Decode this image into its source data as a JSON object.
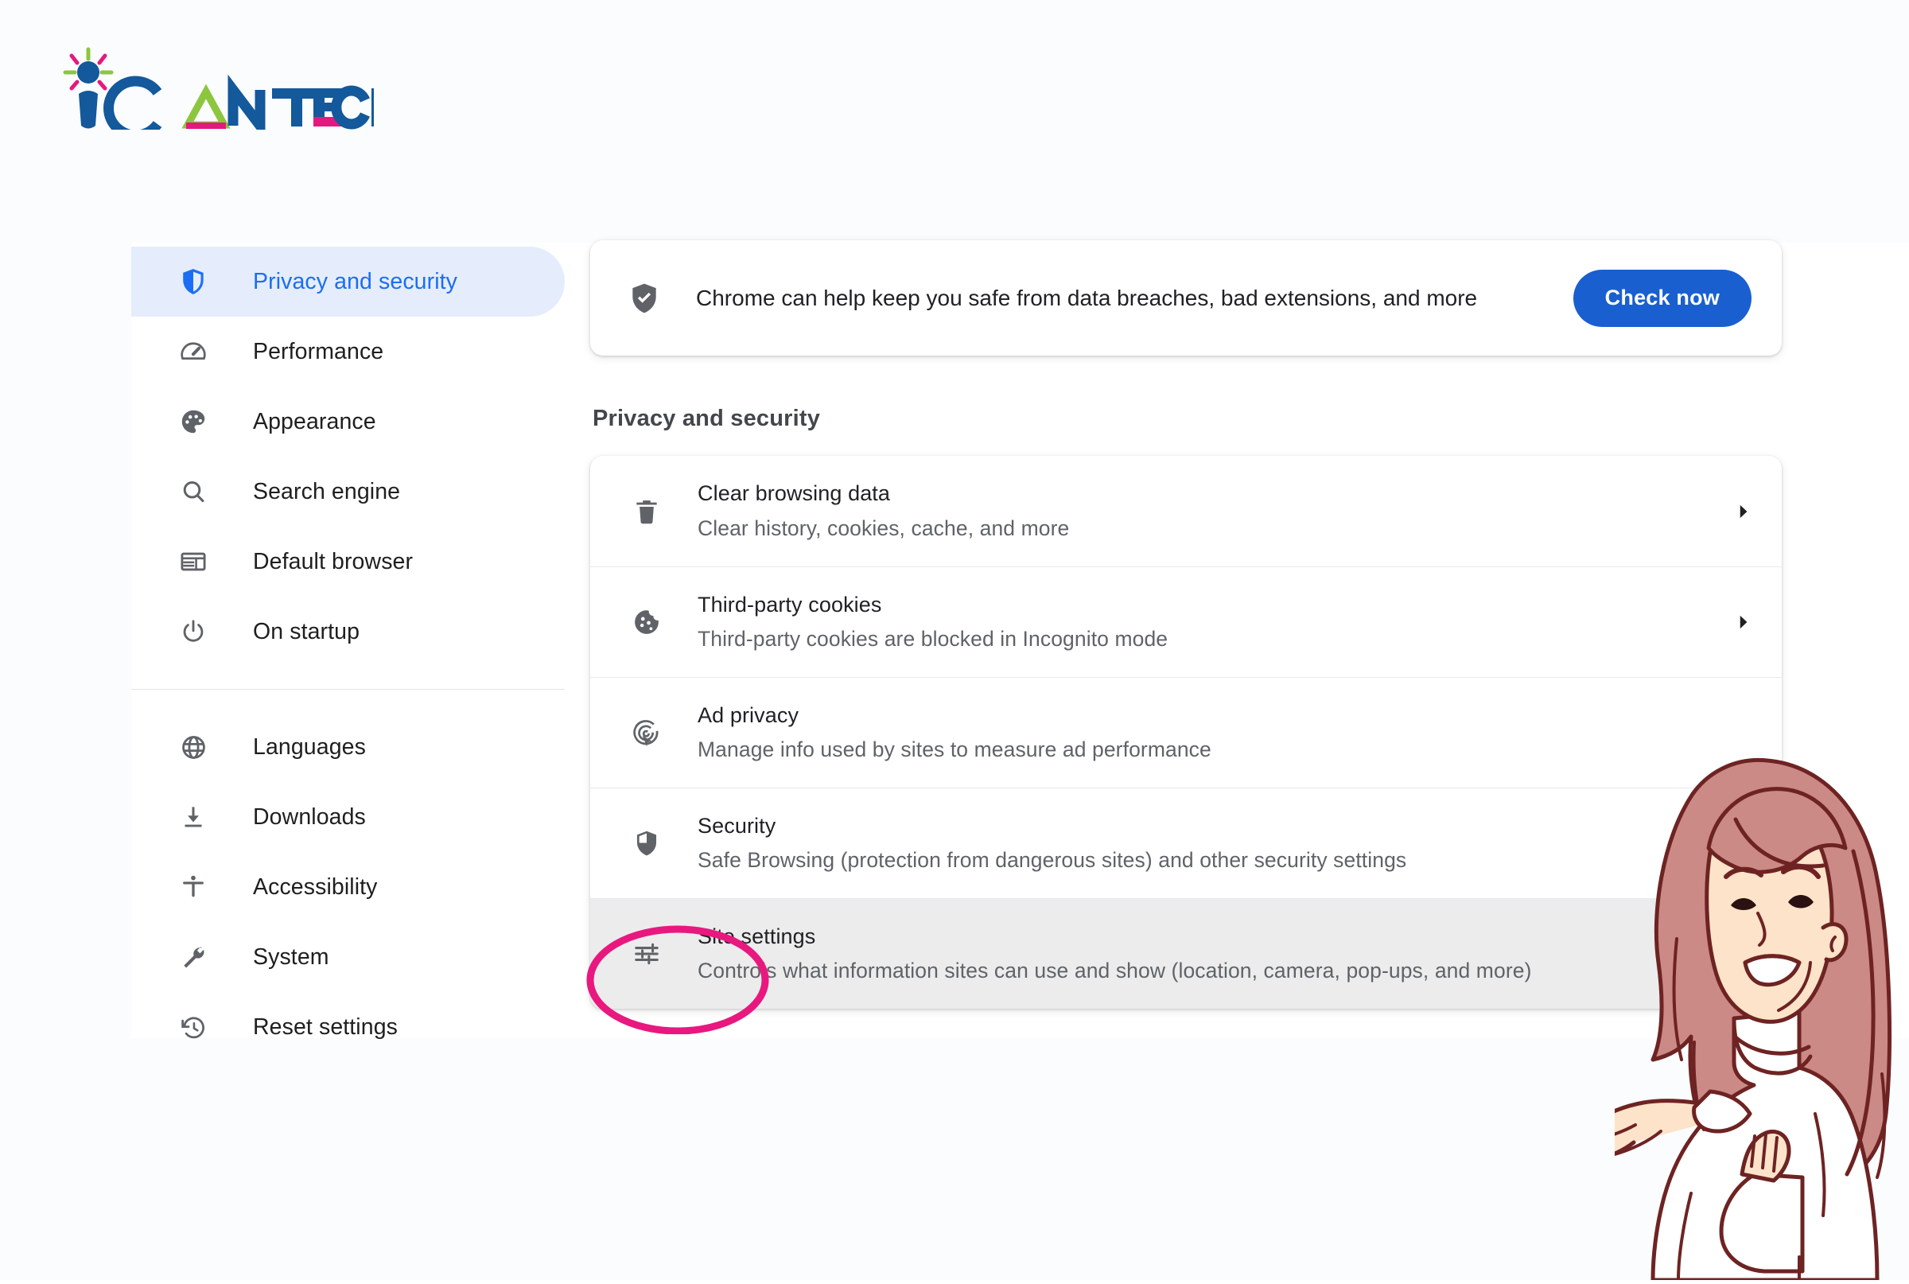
{
  "brand": {
    "name": "iCAN TECH",
    "colors": {
      "blue": "#13599b",
      "green": "#8cc63e",
      "magenta": "#e4197f"
    }
  },
  "sidebar": {
    "group_one": [
      {
        "label": "Privacy and security",
        "icon": "shield-icon",
        "active": true
      },
      {
        "label": "Performance",
        "icon": "speedometer-icon",
        "active": false
      },
      {
        "label": "Appearance",
        "icon": "palette-icon",
        "active": false
      },
      {
        "label": "Search engine",
        "icon": "search-icon",
        "active": false
      },
      {
        "label": "Default browser",
        "icon": "browser-window-icon",
        "active": false
      },
      {
        "label": "On startup",
        "icon": "power-icon",
        "active": false
      }
    ],
    "group_two": [
      {
        "label": "Languages",
        "icon": "globe-icon",
        "active": false
      },
      {
        "label": "Downloads",
        "icon": "download-icon",
        "active": false
      },
      {
        "label": "Accessibility",
        "icon": "accessibility-icon",
        "active": false
      },
      {
        "label": "System",
        "icon": "wrench-icon",
        "active": false
      },
      {
        "label": "Reset settings",
        "icon": "history-restore-icon",
        "active": false
      }
    ]
  },
  "safety_check": {
    "icon": "shield-check-icon",
    "message": "Chrome can help keep you safe from data breaches, bad extensions, and more",
    "button_label": "Check now",
    "button_color": "#1a5fd0"
  },
  "main": {
    "section_title": "Privacy and security",
    "rows": [
      {
        "title": "Clear browsing data",
        "subtitle": "Clear history, cookies, cache, and more",
        "icon": "trash-icon",
        "arrow": "chevron-right-icon",
        "highlighted": false
      },
      {
        "title": "Third-party cookies",
        "subtitle": "Third-party cookies are blocked in Incognito mode",
        "icon": "cookie-icon",
        "arrow": "chevron-right-icon",
        "highlighted": false
      },
      {
        "title": "Ad privacy",
        "subtitle": "Manage info used by sites to measure ad performance",
        "icon": "ad-target-icon",
        "arrow": "",
        "highlighted": false
      },
      {
        "title": "Security",
        "subtitle": "Safe Browsing (protection from dangerous sites) and other security settings",
        "icon": "shield-icon",
        "arrow": "",
        "highlighted": false
      },
      {
        "title": "Site settings",
        "subtitle": "Controls what information sites can use and show (location, camera, pop-ups, and more)",
        "icon": "sliders-icon",
        "arrow": "",
        "highlighted": true
      }
    ]
  },
  "annotation": {
    "shape": "ellipse-highlight",
    "color": "#e8187f",
    "targets": "Site settings"
  },
  "illustration": {
    "name": "woman-presenting-illustration",
    "hair_color": "#cb8a85",
    "skin_color": "#fce3c9",
    "outline_color": "#6e2323"
  }
}
